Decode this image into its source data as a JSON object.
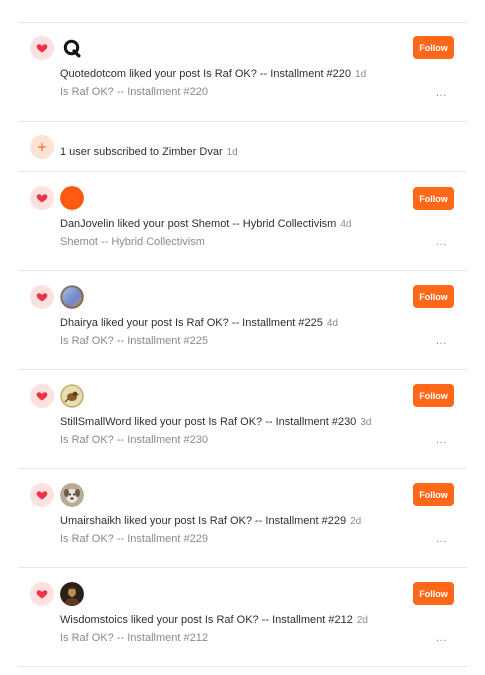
{
  "colors": {
    "accent": "#ff6719",
    "heart": "#ee3344",
    "heart_bg": "#fde0e0",
    "muted_text": "#8a8a8a",
    "divider": "#e6e6e6"
  },
  "notifications": [
    {
      "type": "like",
      "icon": "heart-icon",
      "avatar": "quotedotcom-logo",
      "message": "Quotedotcom liked your post Is Raf OK? -- Installment #220",
      "time": "1d",
      "post_title": "Is Raf OK? -- Installment #220",
      "follow_label": "Follow",
      "more_label": "..."
    },
    {
      "type": "subscription",
      "icon": "plus-icon",
      "message": "1 user subscribed to Zimber Dvar",
      "time": "1d"
    },
    {
      "type": "like",
      "icon": "heart-icon",
      "avatar": "orange-circle-avatar",
      "message": "DanJovelin liked your post Shemot -- Hybrid Collectivism",
      "time": "4d",
      "post_title": "Shemot -- Hybrid Collectivism",
      "follow_label": "Follow",
      "more_label": "..."
    },
    {
      "type": "like",
      "icon": "heart-icon",
      "avatar": "blue-gradient-avatar",
      "message": "Dhairya liked your post Is Raf OK? -- Installment #225",
      "time": "4d",
      "post_title": "Is Raf OK? -- Installment #225",
      "follow_label": "Follow",
      "more_label": "..."
    },
    {
      "type": "like",
      "icon": "heart-icon",
      "avatar": "bird-avatar",
      "message": "StillSmallWord liked your post Is Raf OK? -- Installment #230",
      "time": "3d",
      "post_title": "Is Raf OK? -- Installment #230",
      "follow_label": "Follow",
      "more_label": "..."
    },
    {
      "type": "like",
      "icon": "heart-icon",
      "avatar": "dog-avatar",
      "message": "Umairshaikh liked your post Is Raf OK? -- Installment #229",
      "time": "2d",
      "post_title": "Is Raf OK? -- Installment #229",
      "follow_label": "Follow",
      "more_label": "..."
    },
    {
      "type": "like",
      "icon": "heart-icon",
      "avatar": "portrait-avatar",
      "message": "Wisdomstoics liked your post Is Raf OK? -- Installment #212",
      "time": "2d",
      "post_title": "Is Raf OK? -- Installment #212",
      "follow_label": "Follow",
      "more_label": "..."
    }
  ]
}
